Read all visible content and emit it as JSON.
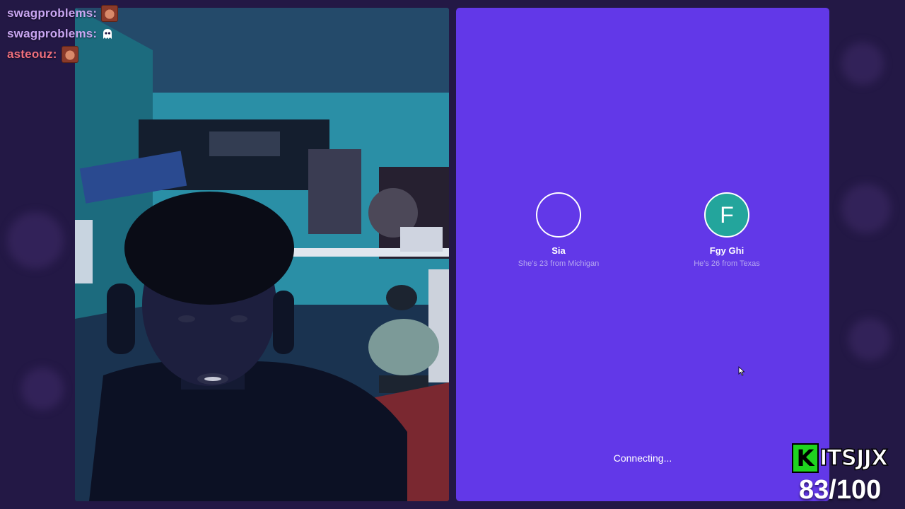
{
  "chat": {
    "messages": [
      {
        "user": "swagproblems:",
        "emote": "angry-face-emote",
        "color": "#c9a6f2"
      },
      {
        "user": "swagproblems:",
        "emote": "ghost-emote",
        "color": "#c9a6f2"
      },
      {
        "user": "asteouz:",
        "emote": "angry-face-emote",
        "color": "#ef6f7c"
      }
    ]
  },
  "panel": {
    "background": "#6238e8",
    "connecting_text": "Connecting...",
    "profiles": [
      {
        "name": "Sia",
        "description": "She's 23 from Michigan",
        "initial": "",
        "state": "loading"
      },
      {
        "name": "Fgy Ghi",
        "description": "He's 26 from Texas",
        "initial": "F",
        "state": "filled",
        "avatar_color": "#23a59c"
      }
    ]
  },
  "overlay": {
    "brand_letter": "K",
    "brand_name": "ITSJJX",
    "brand_color": "#1fd41f",
    "counter": "83/100"
  }
}
